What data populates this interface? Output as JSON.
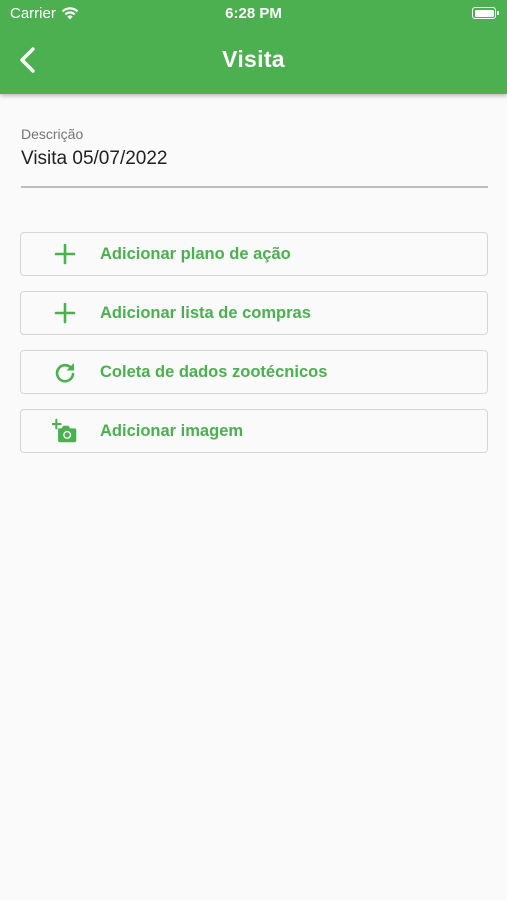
{
  "status_bar": {
    "carrier": "Carrier",
    "time": "6:28 PM"
  },
  "header": {
    "title": "Visita",
    "back_icon": "chevron-left-icon"
  },
  "description_field": {
    "label": "Descrição",
    "value": "Visita 05/07/2022"
  },
  "actions": [
    {
      "label": "Adicionar plano de ação",
      "icon": "plus-icon"
    },
    {
      "label": "Adicionar lista de compras",
      "icon": "plus-icon"
    },
    {
      "label": "Coleta de dados zootécnicos",
      "icon": "refresh-icon"
    },
    {
      "label": "Adicionar imagem",
      "icon": "add-photo-icon"
    }
  ],
  "colors": {
    "primary": "#4caf50",
    "background": "#fafafa",
    "text": "#212121",
    "muted": "#757575"
  }
}
